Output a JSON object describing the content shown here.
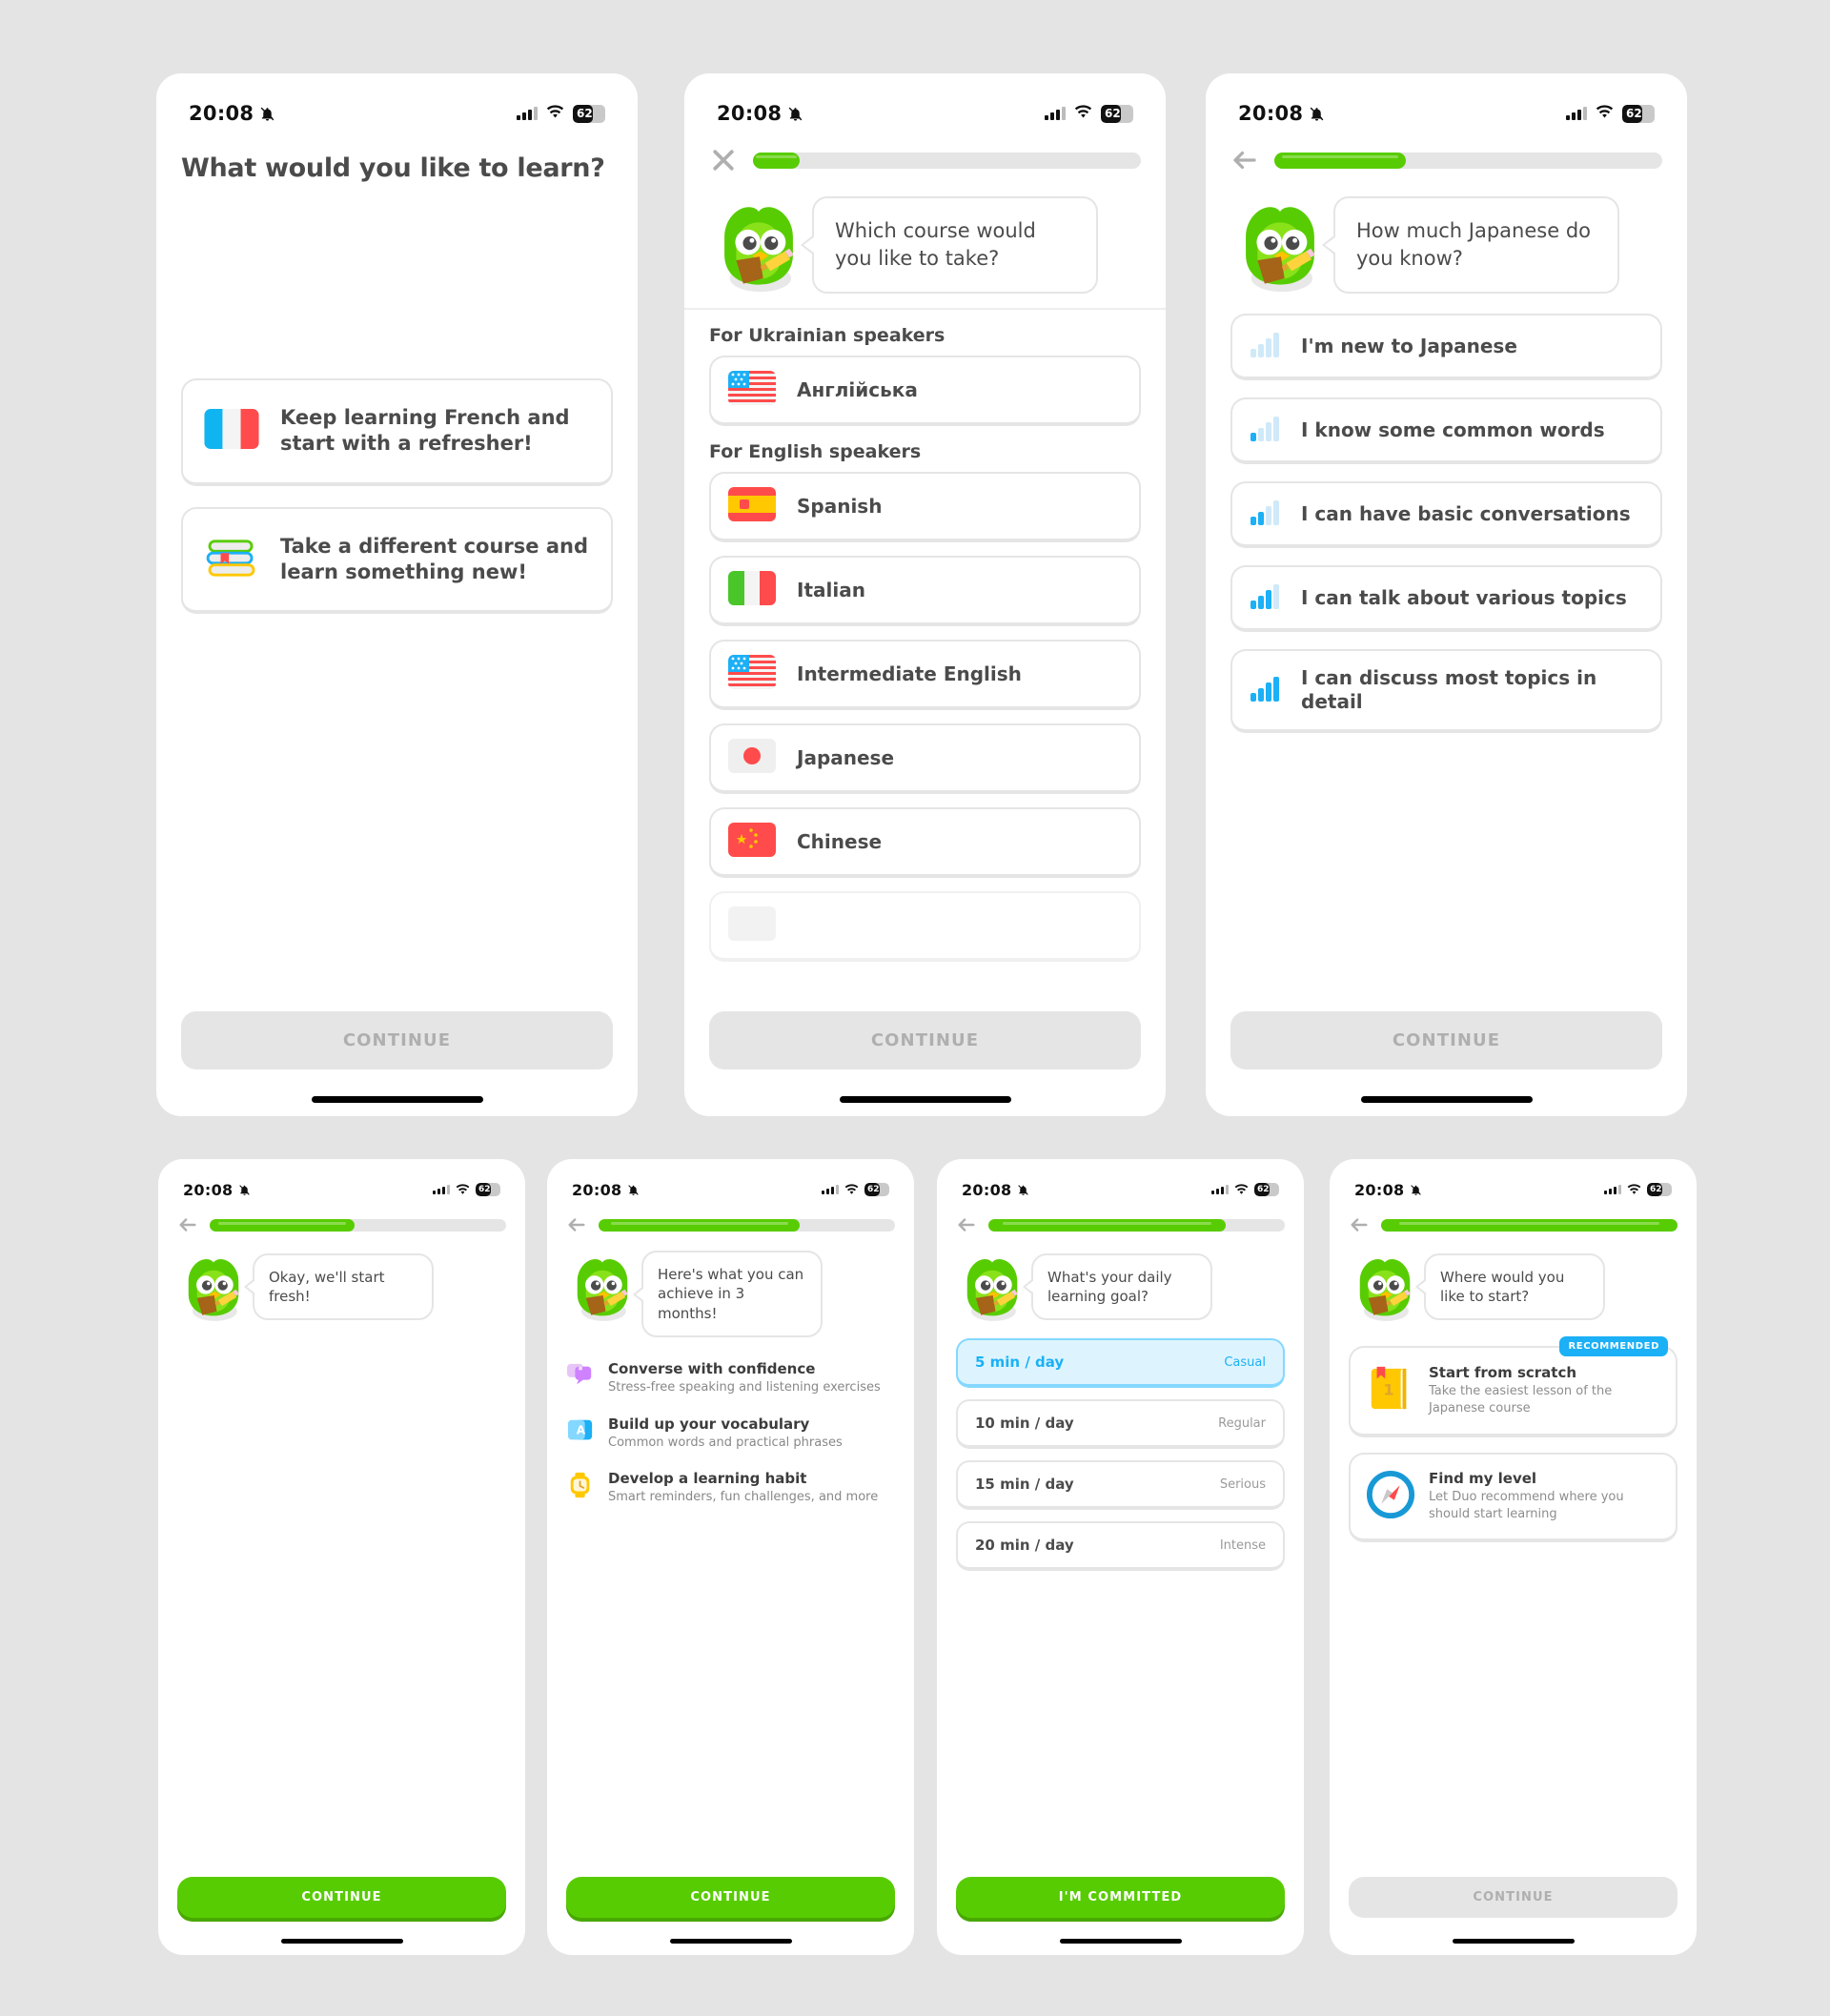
{
  "status_bar": {
    "time": "20:08",
    "battery_percent": "62",
    "bell_icon": "bell-off-icon",
    "signal_icon": "signal-bars-icon",
    "wifi_icon": "wifi-icon"
  },
  "screens": {
    "learn_choice": {
      "title": "What would you like to learn?",
      "options": [
        {
          "icon": "france-flag-icon",
          "label": "Keep learning French and start with a refresher!"
        },
        {
          "icon": "books-stack-icon",
          "label": "Take a different course and learn something new!"
        }
      ],
      "cta": {
        "label": "CONTINUE",
        "enabled": false
      }
    },
    "course_picker": {
      "nav_icon": "close-icon",
      "progress_percent": 12,
      "bubble": "Which course would you like to take?",
      "sections": [
        {
          "heading": "For Ukrainian speakers",
          "courses": [
            {
              "flag": "us-flag-icon",
              "label": "Англійська"
            }
          ]
        },
        {
          "heading": "For English speakers",
          "courses": [
            {
              "flag": "spain-flag-icon",
              "label": "Spanish"
            },
            {
              "flag": "italy-flag-icon",
              "label": "Italian"
            },
            {
              "flag": "us-flag-icon",
              "label": "Intermediate English"
            },
            {
              "flag": "japan-flag-icon",
              "label": "Japanese"
            },
            {
              "flag": "china-flag-icon",
              "label": "Chinese"
            }
          ]
        }
      ],
      "cta": {
        "label": "CONTINUE",
        "enabled": false
      }
    },
    "proficiency": {
      "nav_icon": "back-arrow-icon",
      "progress_percent": 34,
      "bubble": "How much Japanese do you know?",
      "options": [
        {
          "label": "I'm new to Japanese",
          "filled_bars": 0
        },
        {
          "label": "I know some common words",
          "filled_bars": 1
        },
        {
          "label": "I can have basic conversations",
          "filled_bars": 2
        },
        {
          "label": "I can talk about various topics",
          "filled_bars": 3
        },
        {
          "label": "I can discuss most topics in detail",
          "filled_bars": 4
        }
      ],
      "cta": {
        "label": "CONTINUE",
        "enabled": false
      }
    },
    "start_fresh": {
      "nav_icon": "back-arrow-icon",
      "progress_percent": 49,
      "bubble": "Okay, we'll start fresh!",
      "cta": {
        "label": "CONTINUE",
        "enabled": true
      }
    },
    "achievements": {
      "nav_icon": "back-arrow-icon",
      "progress_percent": 68,
      "bubble": "Here's what you can achieve in 3 months!",
      "items": [
        {
          "icon": "chat-bubbles-icon",
          "title": "Converse with confidence",
          "subtitle": "Stress-free speaking and listening exercises"
        },
        {
          "icon": "vocabulary-cards-icon",
          "title": "Build up your vocabulary",
          "subtitle": "Common words and practical phrases"
        },
        {
          "icon": "watch-clock-icon",
          "title": "Develop a learning habit",
          "subtitle": "Smart reminders, fun challenges, and more"
        }
      ],
      "cta": {
        "label": "CONTINUE",
        "enabled": true
      }
    },
    "daily_goal": {
      "nav_icon": "back-arrow-icon",
      "progress_percent": 80,
      "bubble": "What's your daily learning goal?",
      "options": [
        {
          "minutes": "5 min / day",
          "tier": "Casual",
          "selected": true
        },
        {
          "minutes": "10 min / day",
          "tier": "Regular",
          "selected": false
        },
        {
          "minutes": "15 min / day",
          "tier": "Serious",
          "selected": false
        },
        {
          "minutes": "20 min / day",
          "tier": "Intense",
          "selected": false
        }
      ],
      "cta": {
        "label": "I'M COMMITTED",
        "enabled": true
      }
    },
    "start_point": {
      "nav_icon": "back-arrow-icon",
      "progress_percent": 100,
      "bubble": "Where would you like to start?",
      "badge": "RECOMMENDED",
      "options": [
        {
          "icon": "book-one-icon",
          "title": "Start from scratch",
          "subtitle": "Take the easiest lesson of the Japanese course"
        },
        {
          "icon": "compass-icon",
          "title": "Find my level",
          "subtitle": "Let Duo recommend where you should start learning"
        }
      ],
      "cta": {
        "label": "CONTINUE",
        "enabled": false
      }
    }
  },
  "colors": {
    "duo_green": "#58cc02",
    "duo_green_dark": "#48a800",
    "accent_blue": "#1cb0f6",
    "selected_blue_bg": "#ddf4ff",
    "text_dark": "#4b4b4b",
    "border_grey": "#e5e5e5",
    "page_bg": "#e4e4e4"
  }
}
